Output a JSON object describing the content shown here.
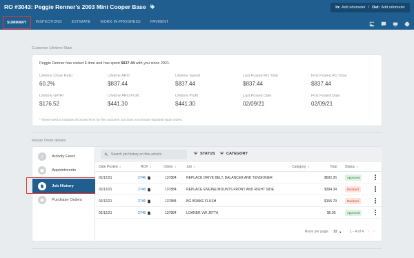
{
  "header": {
    "title": "RO #3043: Peggie Renner's 2003 Mini Cooper Base",
    "odometer_in_label": "In:",
    "odometer_in_value": "Add odometer",
    "odometer_separator": "/",
    "odometer_out_label": "Out:",
    "odometer_out_value": "Add odometer",
    "tabs": [
      "SUMMARY",
      "INSPECTIONS",
      "ESTIMATE",
      "WORK-IN-PROGRESS",
      "PAYMENT"
    ],
    "active_tab": "SUMMARY",
    "icons": [
      "image-icon",
      "message-icon",
      "screen-share-icon",
      "print-icon"
    ]
  },
  "lifetime": {
    "section_title": "Customer Lifetime Stats",
    "intro_prefix": "Peggie Renner has visited",
    "visits": "1",
    "intro_mid": "time and has spent",
    "spent": "$837.44",
    "intro_suffix": "with you since 2021.",
    "stats": [
      {
        "label": "Lifetime Close Ratio",
        "value": "60.2%"
      },
      {
        "label": "Lifetime ARO",
        "value": "$837.44"
      },
      {
        "label": "Lifetime Spend",
        "value": "$837.44"
      },
      {
        "label": "Last Posted RO Total",
        "value": "$837.44"
      },
      {
        "label": "First Posted RO Total",
        "value": "$837.44"
      },
      {
        "label": "Lifetime GP/Hr",
        "value": "$176.52"
      },
      {
        "label": "Lifetime ARO Profit",
        "value": "$441.30"
      },
      {
        "label": "Lifetime Profit",
        "value": "$441.30"
      },
      {
        "label": "Last Posted Date",
        "value": "02/09/21"
      },
      {
        "label": "First Posted Date",
        "value": "02/09/21"
      }
    ],
    "footnote": "* These metrics includes all posted ROs for this customer, but does not include migrated repair orders."
  },
  "repair": {
    "section_title": "Repair Order details",
    "nav": [
      {
        "label": "Activity Feed",
        "icon": "activity-icon"
      },
      {
        "label": "Appointments",
        "icon": "calendar-icon"
      },
      {
        "label": "Job History",
        "icon": "document-icon"
      },
      {
        "label": "Purchase Orders",
        "icon": "purchase-icon"
      }
    ],
    "active_nav": "Job History",
    "search_placeholder": "Search job history on this vehicle",
    "filter_status": "STATUS",
    "filter_category": "CATEGORY",
    "columns": [
      "Date Posted",
      "RO#",
      "Odom",
      "Job",
      "Category",
      "Total",
      "Status"
    ],
    "rows": [
      {
        "date": "02/12/21",
        "ro": "2746",
        "odom": "137884",
        "job": "REPLACE DRIVE BELT, BALANCER AND TENSIONER",
        "category": "",
        "total": "$692.26",
        "status": "Approved"
      },
      {
        "date": "02/12/21",
        "ro": "2746",
        "odom": "137884",
        "job": "REPLACE ENGINE MOUNTS FRONT AND RIGHT SIDE",
        "category": "",
        "total": "$394.34",
        "status": "Declined"
      },
      {
        "date": "02/12/21",
        "ro": "2746",
        "odom": "137884",
        "job": "BG BRAKE FLUSH",
        "category": "",
        "total": "$155.79",
        "status": "Declined"
      },
      {
        "date": "02/12/21",
        "ro": "2746",
        "odom": "137884",
        "job": "LOANER VW JETTA",
        "category": "",
        "total": "$0.00",
        "status": "Approved"
      }
    ],
    "rows_per_page_label": "Rows per page:",
    "rows_per_page": "10",
    "range_label": "1 - 4 of 4"
  }
}
